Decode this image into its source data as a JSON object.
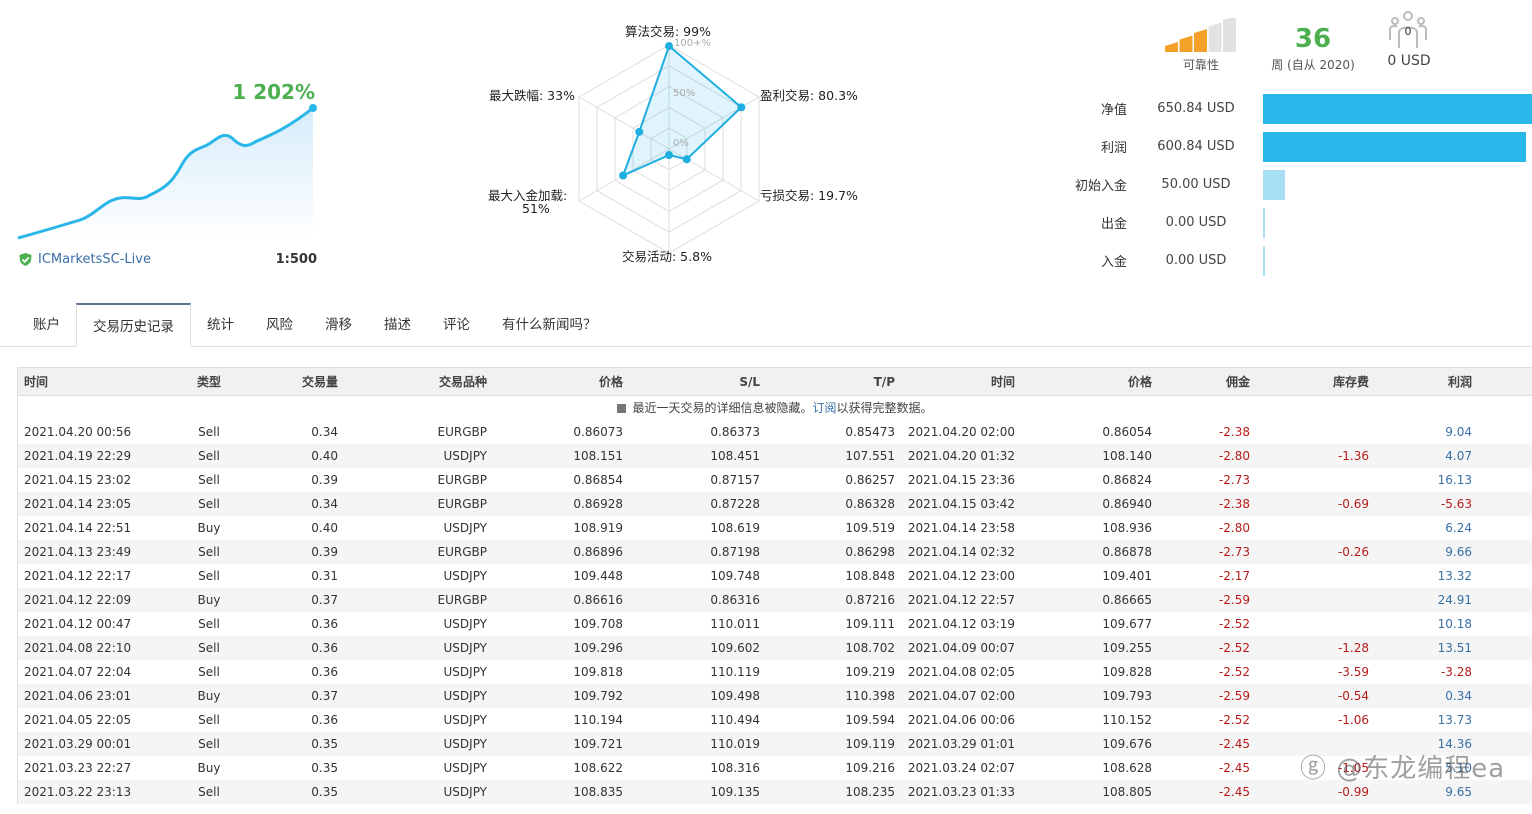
{
  "equity": {
    "gain": "1 202%",
    "server": "ICMarketsSC-Live",
    "leverage": "1:500",
    "line_color": "#29b6e8"
  },
  "radar": {
    "scale_labels": [
      "100+%",
      "50%",
      "0%"
    ],
    "axes": [
      {
        "label": "算法交易: 99%",
        "value": 99
      },
      {
        "label": "盈利交易: 80.3%",
        "value": 80.3
      },
      {
        "label": "亏损交易: 19.7%",
        "value": 19.7
      },
      {
        "label": "交易活动: 5.8%",
        "value": 5.8
      },
      {
        "label": "最大入金加载:",
        "label2": "51%",
        "value": 51
      },
      {
        "label": "最大跌幅: 33%",
        "value": 33
      }
    ]
  },
  "stats": {
    "reliability_label": "可靠性",
    "reliability_level": 3,
    "reliability_max": 5,
    "weeks": "36",
    "weeks_label": "周 (自从 2020)",
    "subscribers": "0",
    "subscribers_funds": "0 USD"
  },
  "balances": [
    {
      "label": "净值",
      "value": "650.84 USD",
      "amount": 650.84,
      "color": "#29b6e8"
    },
    {
      "label": "利润",
      "value": "600.84 USD",
      "amount": 600.84,
      "color": "#29b6e8"
    },
    {
      "label": "初始入金",
      "value": "50.00 USD",
      "amount": 50.0,
      "color": "#a9dff5"
    },
    {
      "label": "出金",
      "value": "0.00 USD",
      "amount": 0,
      "color": "#a9dff5"
    },
    {
      "label": "入金",
      "value": "0.00 USD",
      "amount": 0,
      "color": "#a9dff5"
    }
  ],
  "tabs": [
    "账户",
    "交易历史记录",
    "统计",
    "风险",
    "滑移",
    "描述",
    "评论",
    "有什么新闻吗？"
  ],
  "active_tab": 1,
  "table": {
    "headers": [
      "时间",
      "类型",
      "交易量",
      "交易品种",
      "价格",
      "S/L",
      "T/P",
      "时间",
      "价格",
      "佣金",
      "库存费",
      "利润"
    ],
    "notice": "最近一天交易的详细信息被隐藏。",
    "notice_link": "订阅",
    "notice_tail": "以获得完整数据。",
    "rows": [
      [
        "2021.04.20 00:56",
        "Sell",
        "0.34",
        "EURGBP",
        "0.86073",
        "0.86373",
        "0.85473",
        "2021.04.20 02:00",
        "0.86054",
        "-2.38",
        "",
        "9.04"
      ],
      [
        "2021.04.19 22:29",
        "Sell",
        "0.40",
        "USDJPY",
        "108.151",
        "108.451",
        "107.551",
        "2021.04.20 01:32",
        "108.140",
        "-2.80",
        "-1.36",
        "4.07"
      ],
      [
        "2021.04.15 23:02",
        "Sell",
        "0.39",
        "EURGBP",
        "0.86854",
        "0.87157",
        "0.86257",
        "2021.04.15 23:36",
        "0.86824",
        "-2.73",
        "",
        "16.13"
      ],
      [
        "2021.04.14 23:05",
        "Sell",
        "0.34",
        "EURGBP",
        "0.86928",
        "0.87228",
        "0.86328",
        "2021.04.15 03:42",
        "0.86940",
        "-2.38",
        "-0.69",
        "-5.63"
      ],
      [
        "2021.04.14 22:51",
        "Buy",
        "0.40",
        "USDJPY",
        "108.919",
        "108.619",
        "109.519",
        "2021.04.14 23:58",
        "108.936",
        "-2.80",
        "",
        "6.24"
      ],
      [
        "2021.04.13 23:49",
        "Sell",
        "0.39",
        "EURGBP",
        "0.86896",
        "0.87198",
        "0.86298",
        "2021.04.14 02:32",
        "0.86878",
        "-2.73",
        "-0.26",
        "9.66"
      ],
      [
        "2021.04.12 22:17",
        "Sell",
        "0.31",
        "USDJPY",
        "109.448",
        "109.748",
        "108.848",
        "2021.04.12 23:00",
        "109.401",
        "-2.17",
        "",
        "13.32"
      ],
      [
        "2021.04.12 22:09",
        "Buy",
        "0.37",
        "EURGBP",
        "0.86616",
        "0.86316",
        "0.87216",
        "2021.04.12 22:57",
        "0.86665",
        "-2.59",
        "",
        "24.91"
      ],
      [
        "2021.04.12 00:47",
        "Sell",
        "0.36",
        "USDJPY",
        "109.708",
        "110.011",
        "109.111",
        "2021.04.12 03:19",
        "109.677",
        "-2.52",
        "",
        "10.18"
      ],
      [
        "2021.04.08 22:10",
        "Sell",
        "0.36",
        "USDJPY",
        "109.296",
        "109.602",
        "108.702",
        "2021.04.09 00:07",
        "109.255",
        "-2.52",
        "-1.28",
        "13.51"
      ],
      [
        "2021.04.07 22:04",
        "Sell",
        "0.36",
        "USDJPY",
        "109.818",
        "110.119",
        "109.219",
        "2021.04.08 02:05",
        "109.828",
        "-2.52",
        "-3.59",
        "-3.28"
      ],
      [
        "2021.04.06 23:01",
        "Buy",
        "0.37",
        "USDJPY",
        "109.792",
        "109.498",
        "110.398",
        "2021.04.07 02:00",
        "109.793",
        "-2.59",
        "-0.54",
        "0.34"
      ],
      [
        "2021.04.05 22:05",
        "Sell",
        "0.36",
        "USDJPY",
        "110.194",
        "110.494",
        "109.594",
        "2021.04.06 00:06",
        "110.152",
        "-2.52",
        "-1.06",
        "13.73"
      ],
      [
        "2021.03.29 00:01",
        "Sell",
        "0.35",
        "USDJPY",
        "109.721",
        "110.019",
        "109.119",
        "2021.03.29 01:01",
        "109.676",
        "-2.45",
        "",
        "14.36"
      ],
      [
        "2021.03.23 22:27",
        "Buy",
        "0.35",
        "USDJPY",
        "108.622",
        "108.316",
        "109.216",
        "2021.03.24 02:07",
        "108.628",
        "-2.45",
        "-1.05",
        "5.10"
      ],
      [
        "2021.03.22 23:13",
        "Sell",
        "0.35",
        "USDJPY",
        "108.835",
        "109.135",
        "108.235",
        "2021.03.23 01:33",
        "108.805",
        "-2.45",
        "-0.99",
        "9.65"
      ]
    ]
  },
  "watermark": "@东龙编程ea"
}
